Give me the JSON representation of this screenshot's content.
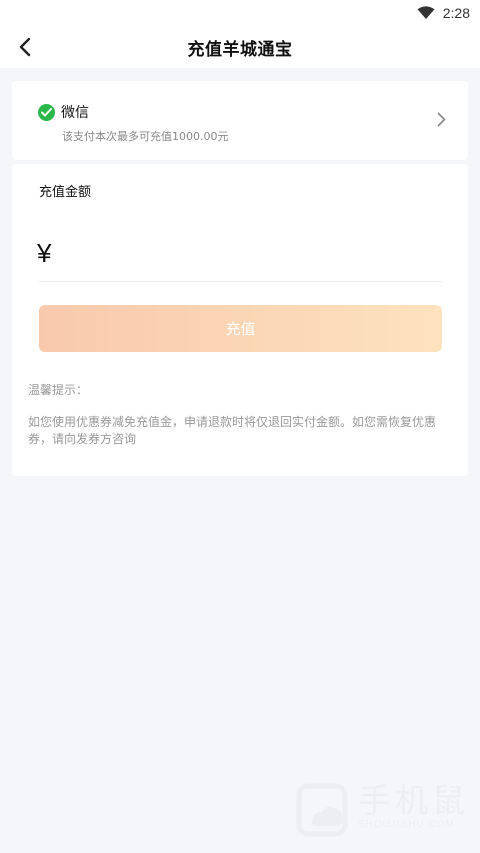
{
  "status_bar": {
    "time": "2:28",
    "wifi_icon": "wifi-icon"
  },
  "header": {
    "title": "充值羊城通宝",
    "back_icon": "back-arrow-icon"
  },
  "payment": {
    "method": "微信",
    "limit_text": "该支付本次最多可充值1000.00元",
    "icon": "check-circle-icon",
    "chevron_icon": "chevron-right-icon",
    "accent_color": "#29b849"
  },
  "amount": {
    "label": "充值金额",
    "currency_symbol": "¥",
    "input_value": "",
    "submit_label": "充值"
  },
  "tips": {
    "title": "温馨提示：",
    "body": "如您使用优惠券减免充值金，申请退款时将仅退回实付金额。如您需恢复优惠券，请向发券方咨询"
  },
  "watermark": {
    "text_cn": "手机鼠",
    "text_en": "SHOUJISHU.COM"
  }
}
